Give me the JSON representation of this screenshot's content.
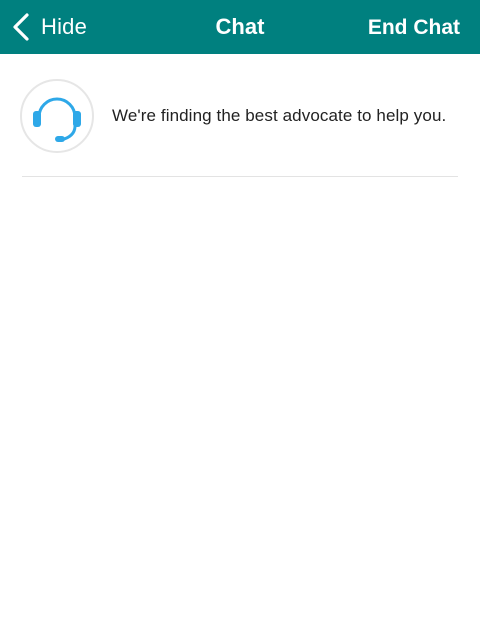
{
  "nav": {
    "hide_label": "Hide",
    "title": "Chat",
    "end_label": "End Chat"
  },
  "status": {
    "message": "We're finding the best advocate to help you."
  },
  "icons": {
    "back": "chevron-left-icon",
    "agent": "headset-icon"
  },
  "colors": {
    "nav_background": "#00807f",
    "nav_text": "#ffffff",
    "headset": "#2ea8e8",
    "avatar_border": "#e6e6e6",
    "divider": "#e3e3e3"
  }
}
